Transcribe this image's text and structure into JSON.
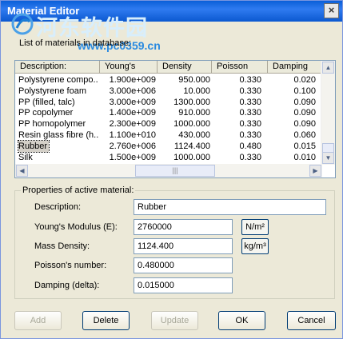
{
  "window": {
    "title": "Material Editor",
    "close_icon": "×"
  },
  "watermark": {
    "text": "河东软件园",
    "url": "www.pc0359.cn"
  },
  "list": {
    "caption": "List of materials in database:",
    "columns": [
      "Description:",
      "Young's",
      "Density",
      "Poisson",
      "Damping"
    ],
    "rows": [
      [
        "Polystyrene compo...",
        "1.900e+009",
        "950.000",
        "0.330",
        "0.020"
      ],
      [
        "Polystyrene foam",
        "3.000e+006",
        "10.000",
        "0.330",
        "0.100"
      ],
      [
        "PP (filled, talc)",
        "3.000e+009",
        "1300.000",
        "0.330",
        "0.090"
      ],
      [
        "PP copolymer",
        "1.400e+009",
        "910.000",
        "0.330",
        "0.090"
      ],
      [
        "PP homopolymer",
        "2.300e+009",
        "1000.000",
        "0.330",
        "0.090"
      ],
      [
        "Resin glass fibre (h...",
        "1.100e+010",
        "430.000",
        "0.330",
        "0.060"
      ],
      [
        "Rubber",
        "2.760e+006",
        "1124.400",
        "0.480",
        "0.015"
      ],
      [
        "Silk",
        "1.500e+009",
        "1000.000",
        "0.330",
        "0.010"
      ]
    ],
    "selected_row": 6
  },
  "properties": {
    "group_label": "Properties of active material:",
    "description_label": "Description:",
    "description_value": "Rubber",
    "youngs_label": "Young's Modulus (E):",
    "youngs_value": "2760000",
    "youngs_unit": "N/m²",
    "density_label": "Mass Density:",
    "density_value": "1124.400",
    "density_unit": "kg/m³",
    "poisson_label": "Poisson's number:",
    "poisson_value": "0.480000",
    "damping_label": "Damping (delta):",
    "damping_value": "0.015000"
  },
  "buttons": {
    "add": "Add",
    "delete": "Delete",
    "update": "Update",
    "ok": "OK",
    "cancel": "Cancel"
  }
}
